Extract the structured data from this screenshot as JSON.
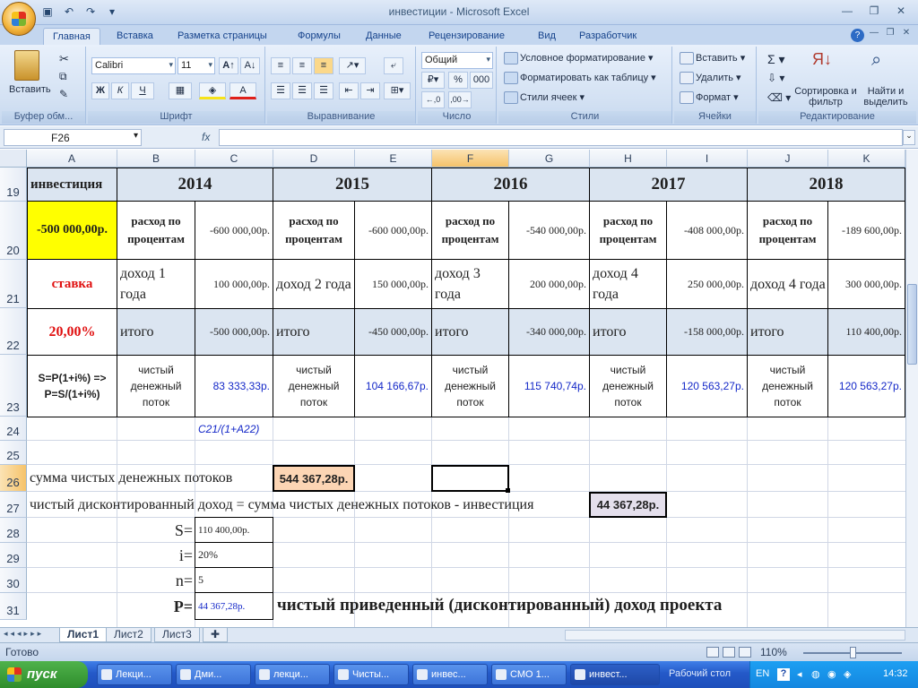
{
  "window": {
    "title": "инвестиции - Microsoft Excel"
  },
  "ribbon_tabs": [
    "Главная",
    "Вставка",
    "Разметка страницы",
    "Формулы",
    "Данные",
    "Рецензирование",
    "Вид",
    "Разработчик"
  ],
  "ribbon": {
    "clipboard": {
      "paste": "Вставить",
      "label": "Буфер обм..."
    },
    "font": {
      "name": "Calibri",
      "size": "11",
      "bold": "Ж",
      "italic": "К",
      "underline": "Ч",
      "label": "Шрифт"
    },
    "alignment": {
      "label": "Выравнивание"
    },
    "number": {
      "format": "Общий",
      "percent": "%",
      "thousands": "000",
      "label": "Число"
    },
    "styles": {
      "conditional": "Условное форматирование",
      "as_table": "Форматировать как таблицу",
      "cell_styles": "Стили ячеек",
      "label": "Стили"
    },
    "cells": {
      "insert": "Вставить",
      "delete": "Удалить",
      "format": "Формат",
      "label": "Ячейки"
    },
    "editing": {
      "sort": "Сортировка и фильтр",
      "find": "Найти и выделить",
      "label": "Редактирование"
    }
  },
  "formula_bar": {
    "name_box": "F26",
    "fx": "fx",
    "value": ""
  },
  "columns": [
    "A",
    "B",
    "C",
    "D",
    "E",
    "F",
    "G",
    "H",
    "I",
    "J",
    "K"
  ],
  "rows": [
    "19",
    "20",
    "21",
    "22",
    "23",
    "24",
    "25",
    "26",
    "27",
    "28",
    "29",
    "30",
    "31"
  ],
  "sheet": {
    "A19": "инвестиция",
    "years": [
      "2014",
      "2015",
      "2016",
      "2017",
      "2018"
    ],
    "A20": "-500 000,00р.",
    "expense_label": "расход по процентам",
    "expense": [
      "-600 000,00р.",
      "-600 000,00р.",
      "-540 000,00р.",
      "-408 000,00р.",
      "-189 600,00р."
    ],
    "A21": "ставка",
    "income_labels": [
      "доход 1 года",
      "доход 2 года",
      "доход 3 года",
      "доход 4 года",
      "доход 4 года"
    ],
    "income": [
      "100 000,00р.",
      "150 000,00р.",
      "200 000,00р.",
      "250 000,00р.",
      "300 000,00р."
    ],
    "A22": "20,00%",
    "total_label": "итого",
    "total": [
      "-500 000,00р.",
      "-450 000,00р.",
      "-340 000,00р.",
      "-158 000,00р.",
      "110 400,00р."
    ],
    "A23": "S=P(1+i%) => P=S/(1+i%)",
    "cashflow_label": "чистый денежный поток",
    "cashflow": [
      "83 333,33р.",
      "104 166,67р.",
      "115 740,74р.",
      "120 563,27р.",
      "120 563,27р."
    ],
    "C24": "C21/(1+A22)",
    "A26": "сумма чистых денежных потоков",
    "D26": "544 367,28р.",
    "A27": "чистый дисконтированный доход = сумма чистых денежных потоков - инвестиция",
    "H27": "44 367,28р.",
    "B28": "S=",
    "C28": "110 400,00р.",
    "B29": "i=",
    "C29": "20%",
    "B30": "n=",
    "C30": "5",
    "B31": "P=",
    "C31": "44 367,28р.",
    "D31": "чистый приведенный (дисконтированный) доход проекта"
  },
  "sheet_tabs": [
    "Лист1",
    "Лист2",
    "Лист3"
  ],
  "status": {
    "ready": "Готово",
    "zoom": "110%"
  },
  "taskbar": {
    "start": "пуск",
    "tasks": [
      "Лекци...",
      "Дми...",
      "лекци...",
      "Чисты...",
      "инвес...",
      "СМО 1...",
      "инвест..."
    ],
    "desktop": "Рабочий стол",
    "lang": "EN",
    "time": "14:32"
  }
}
